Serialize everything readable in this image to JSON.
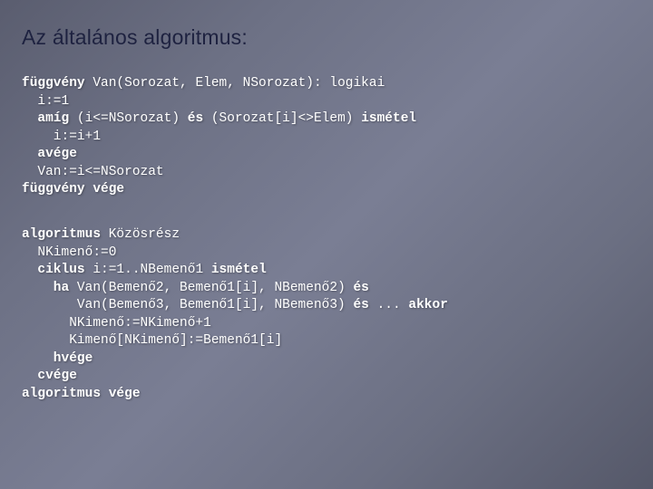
{
  "title": "Az általános algoritmus:",
  "code1": {
    "l1a": "függvény",
    "l1b": " Van(Sorozat, Elem, NSorozat): logikai",
    "l2": "  i:=1",
    "l3a": "  amíg",
    "l3b": " (i<=NSorozat) ",
    "l3c": "és",
    "l3d": " (Sorozat[i]<>Elem) ",
    "l3e": "ismétel",
    "l4": "    i:=i+1",
    "l5": "  avége",
    "l6": "  Van:=i<=NSorozat",
    "l7": "függvény vége"
  },
  "code2": {
    "l1a": "algoritmus",
    "l1b": " Közösrész",
    "l2": "  NKimenő:=0",
    "l3a": "  ciklus",
    "l3b": " i:=1..NBemenő1 ",
    "l3c": "ismétel",
    "l4a": "    ha",
    "l4b": " Van(Bemenő2, Bemenő1[i], NBemenő2) ",
    "l4c": "és",
    "l5a": "       Van(Bemenő3, Bemenő1[i], NBemenő3) ",
    "l5b": "és",
    "l5c": " ... ",
    "l5d": "akkor",
    "l6": "      NKimenő:=NKimenő+1",
    "l7": "      Kimenő[NKimenő]:=Bemenő1[i]",
    "l8": "    hvége",
    "l9": "  cvége",
    "l10": "algoritmus vége"
  }
}
